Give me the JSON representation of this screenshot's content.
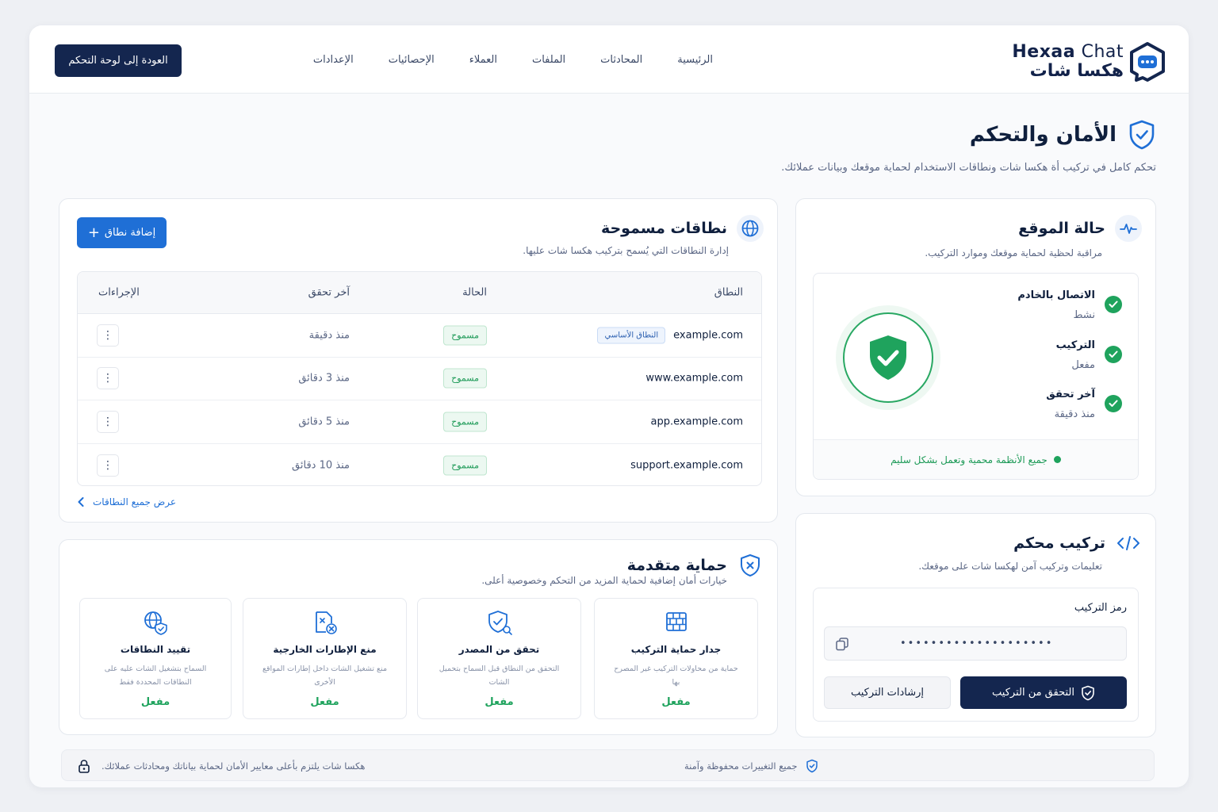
{
  "brand": {
    "name_en_bold": "Hexaa",
    "name_en_light": " Chat",
    "name_ar": "هكسا شات"
  },
  "nav": {
    "items": [
      "الرئيسية",
      "المحادثات",
      "الملفات",
      "العملاء",
      "الإحصائيات",
      "الإعدادات"
    ]
  },
  "header": {
    "back_label": "العودة إلى لوحة التحكم"
  },
  "page": {
    "title": "الأمان والتحكم",
    "subtitle": "تحكم كامل في تركيب أة هكسا شات ونطاقات الاستخدام لحماية موقعك وبيانات عملائك."
  },
  "domains": {
    "title": "نطاقات مسموحة",
    "subtitle": "إدارة النطاقات التي يُسمح بتركيب هكسا شات عليها.",
    "add_label": "إضافة نطاق",
    "columns": [
      "النطاق",
      "الحالة",
      "آخر تحقق",
      "الإجراءات"
    ],
    "rows": [
      {
        "domain": "example.com",
        "tag": "النطاق الأساسي",
        "status": "مسموح",
        "checked": "منذ دقيقة"
      },
      {
        "domain": "www.example.com",
        "tag": "",
        "status": "مسموح",
        "checked": "منذ 3 دقائق"
      },
      {
        "domain": "app.example.com",
        "tag": "",
        "status": "مسموح",
        "checked": "منذ 5 دقائق"
      },
      {
        "domain": "support.example.com",
        "tag": "",
        "status": "مسموح",
        "checked": "منذ 10 دقائق"
      }
    ],
    "view_all": "عرض جميع النطاقات"
  },
  "site_status": {
    "title": "حالة الموقع",
    "subtitle": "مراقبة لحظية لحماية موقعك وموارد التركيب.",
    "items": [
      {
        "label": "الاتصال بالخادم",
        "value": "نشط"
      },
      {
        "label": "التركيب",
        "value": "مفعل"
      },
      {
        "label": "آخر تحقق",
        "value": "منذ دقيقة"
      }
    ],
    "footer": "جميع الأنظمة محمية وتعمل بشكل سليم"
  },
  "install": {
    "title": "تركيب محكم",
    "subtitle": "تعليمات وتركيب آمن لهكسا شات على موقعك.",
    "code_label": "رمز التركيب",
    "code_value": "••••••••••••••••••••",
    "verify_label": "التحقق من التركيب",
    "guide_label": "إرشادات التركيب"
  },
  "advanced": {
    "title": "حماية متقدمة",
    "subtitle": "خيارات أمان إضافية لحماية المزيد من التحكم وخصوصية أعلى.",
    "features": [
      {
        "title": "جدار حماية التركيب",
        "desc": "حماية من محاولات التركيب غير المصرح بها",
        "state": "مفعل",
        "icon": "firewall-icon"
      },
      {
        "title": "تحقق من المصدر",
        "desc": "التحقق من النطاق قبل السماح بتحميل الشات",
        "state": "مفعل",
        "icon": "shield-check-icon"
      },
      {
        "title": "منع الإطارات الخارجية",
        "desc": "منع تشغيل الشات داخل إطارات المواقع الأخرى",
        "state": "مفعل",
        "icon": "frame-block-icon"
      },
      {
        "title": "تقييد النطاقات",
        "desc": "السماح بتشغيل الشات عليه على النطاقات المحددة فقط",
        "state": "مفعل",
        "icon": "globe-shield-icon"
      }
    ]
  },
  "footer": {
    "saved_note": "جميع التغييرات محفوظة وآمنة",
    "commitment": "هكسا شات يلتزم بأعلى معايير الأمان لحماية بياناتك ومحادثات عملائك."
  },
  "colors": {
    "primary_dark": "#14264f",
    "accent_blue": "#1f6fd6",
    "success_green": "#1fa35d"
  }
}
